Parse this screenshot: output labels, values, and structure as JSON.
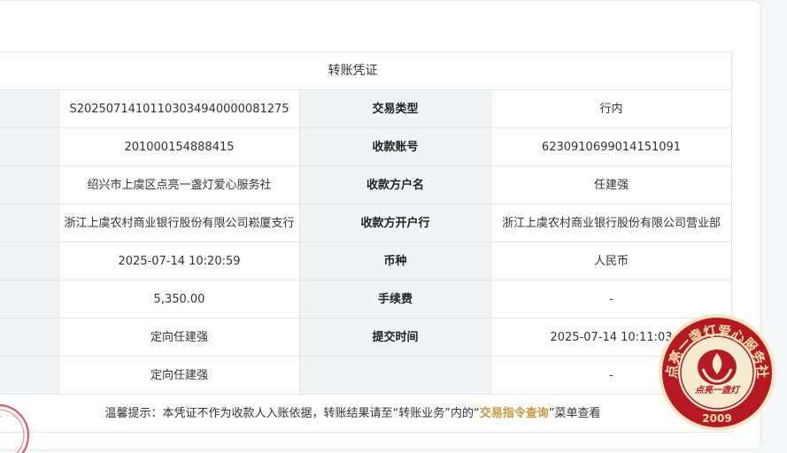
{
  "voucher": {
    "title": "转账凭证",
    "rows": [
      {
        "left_value": "S20250714101103034940000081275",
        "right_label": "交易类型",
        "right_value": "行内"
      },
      {
        "left_value": "201000154888415",
        "right_label": "收款账号",
        "right_value": "6230910699014151091"
      },
      {
        "left_value": "绍兴市上虞区点亮一盏灯爱心服务社",
        "right_label": "收款方户名",
        "right_value": "任建强"
      },
      {
        "left_value": "浙江上虞农村商业银行股份有限公司崧厦支行",
        "right_label": "收款方开户行",
        "right_value": "浙江上虞农村商业银行股份有限公司营业部"
      },
      {
        "left_value": "2025-07-14 10:20:59",
        "right_label": "币种",
        "right_value": "人民币"
      },
      {
        "left_value": "5,350.00",
        "right_label": "手续费",
        "right_value": "-"
      },
      {
        "left_value": "定向任建强",
        "right_label": "提交时间",
        "right_value": "2025-07-14 10:11:03"
      },
      {
        "left_value": "定向任建强",
        "right_label": "",
        "right_value": "-"
      }
    ],
    "tip": {
      "prefix": "温馨提示：本凭证不作为收款人入账依据，转账结果请至“转账业务”内的“",
      "link": "交易指令查询",
      "suffix": "”菜单查看"
    }
  },
  "stamp": {
    "arc_text": "点亮一盏灯爱心服务社",
    "inner_text": "点亮一盏灯",
    "year": "2009",
    "color": "#c8102e"
  },
  "colors": {
    "label_bg": "#f2f3f5",
    "border": "#e3e5e8",
    "link": "#c8963e"
  }
}
